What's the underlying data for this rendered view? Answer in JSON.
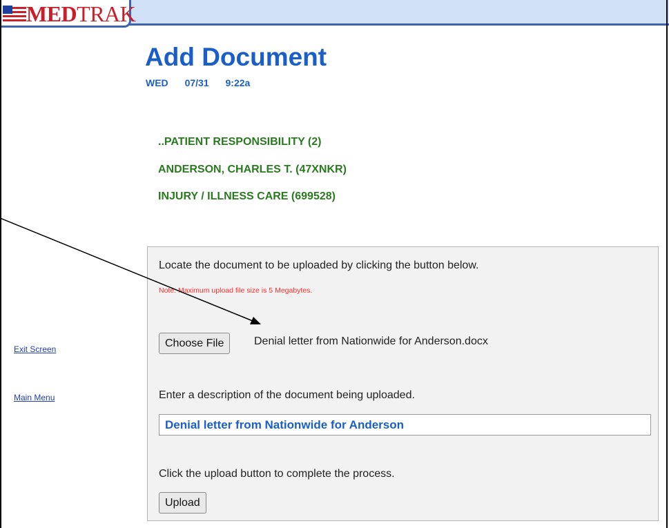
{
  "logo": {
    "text_a": "MED",
    "text_b": "TRAK"
  },
  "header": {
    "title": "Add Document",
    "day": "WED",
    "date": "07/31",
    "time": "9:22a"
  },
  "context": {
    "line1": "..PATIENT RESPONSIBILITY (2)",
    "line2": "ANDERSON, CHARLES T. (47XNKR)",
    "line3": "INJURY / ILLNESS CARE (699528)"
  },
  "sidebar": {
    "exit": "Exit Screen",
    "main": "Main Menu"
  },
  "upload": {
    "instruction": "Locate the document to be uploaded by clicking the button below.",
    "note": "Note: Maximum upload file size is 5 Megabytes.",
    "choose_label": "Choose File",
    "filename": "Denial letter from Nationwide for Anderson.docx",
    "desc_prompt": "Enter a description of the document being uploaded.",
    "desc_value": "Denial letter from Nationwide for Anderson",
    "complete_prompt": "Click the upload button to complete the process.",
    "upload_label": "Upload"
  },
  "colors": {
    "title": "#1a5fc7",
    "context": "#2a7a1f",
    "note": "#ff2a2a",
    "topbar": "#cfe0f7",
    "accent": "#3a63b0"
  },
  "icons": {
    "logo_flag": "flag-icon"
  }
}
